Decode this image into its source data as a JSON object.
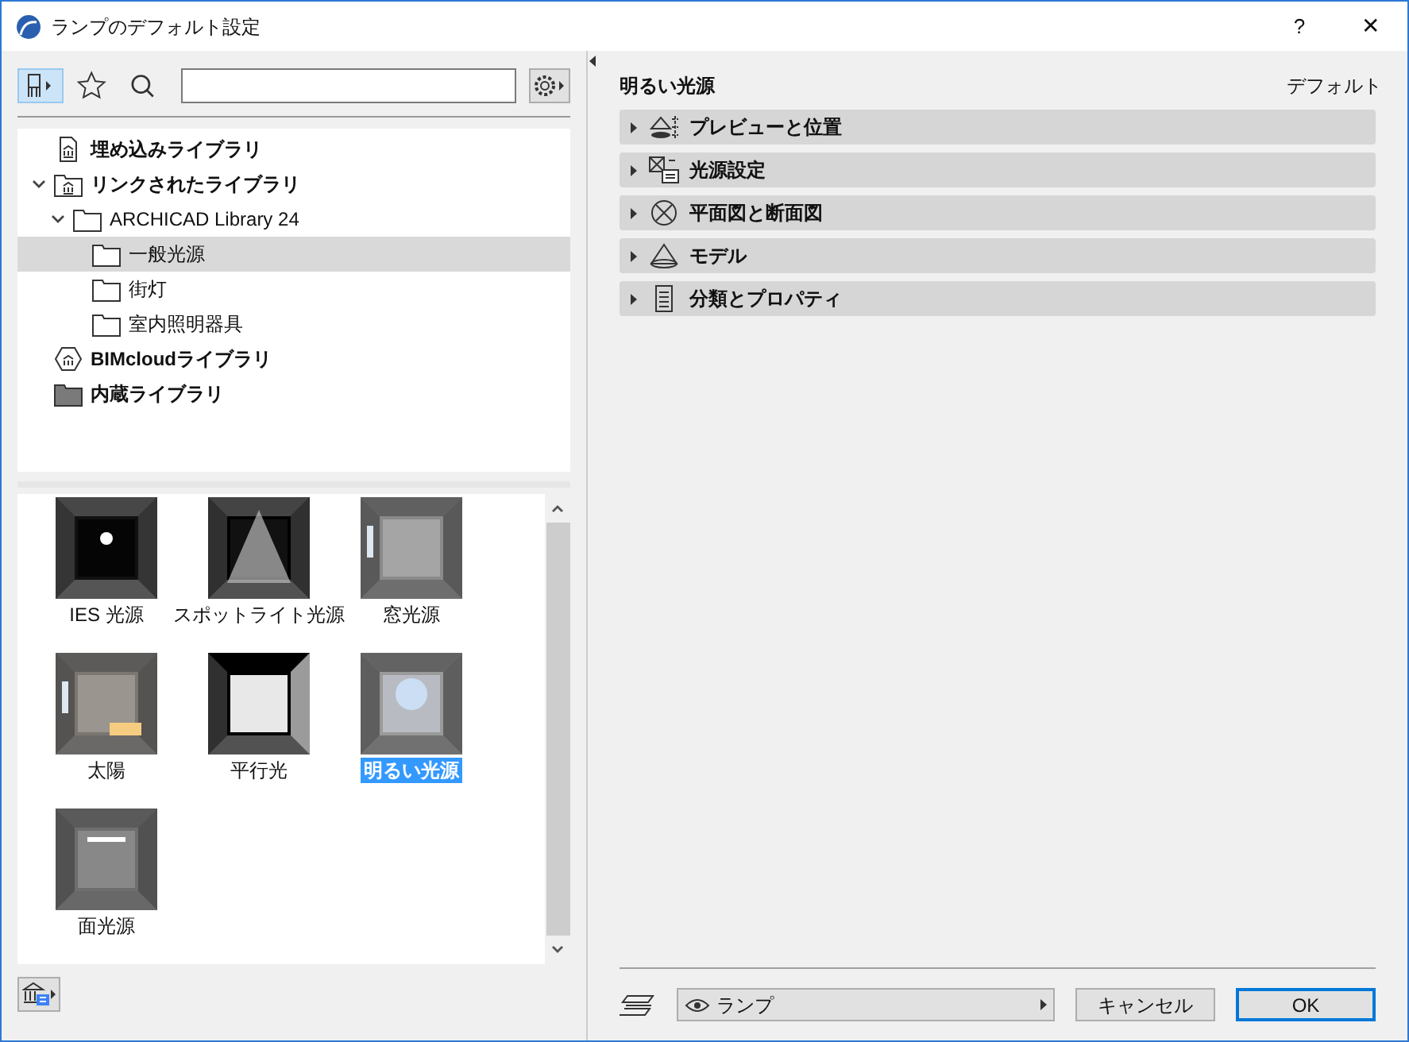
{
  "window": {
    "title": "ランプのデフォルト設定",
    "help": "?",
    "close": "✕"
  },
  "tree": [
    {
      "kind": "embedded",
      "label": "埋め込みライブラリ",
      "bold": true,
      "selected": false
    },
    {
      "kind": "linked",
      "label": "リンクされたライブラリ",
      "bold": true,
      "selected": false,
      "expanded": true,
      "children": [
        {
          "kind": "folder",
          "label": "ARCHICAD Library 24",
          "bold": false,
          "selected": false,
          "expanded": true,
          "children": [
            {
              "kind": "folder",
              "label": "一般光源",
              "bold": false,
              "selected": true
            },
            {
              "kind": "folder",
              "label": "街灯",
              "bold": false,
              "selected": false
            },
            {
              "kind": "folder",
              "label": "室内照明器具",
              "bold": false,
              "selected": false
            }
          ]
        }
      ]
    },
    {
      "kind": "bimcloud",
      "label": "BIMcloudライブラリ",
      "bold": true,
      "selected": false
    },
    {
      "kind": "builtin",
      "label": "内蔵ライブラリ",
      "bold": true,
      "selected": false
    }
  ],
  "gallery": [
    {
      "label": "IES 光源",
      "selected": false
    },
    {
      "label": "スポットライト光源",
      "selected": false
    },
    {
      "label": "窓光源",
      "selected": false
    },
    {
      "label": "太陽",
      "selected": false
    },
    {
      "label": "平行光",
      "selected": false
    },
    {
      "label": "明るい光源",
      "selected": true
    },
    {
      "label": "面光源",
      "selected": false
    }
  ],
  "settings": {
    "title": "明るい光源",
    "default_label": "デフォルト",
    "sections": [
      {
        "kind": "preview",
        "label": "プレビューと位置",
        "expanded": false
      },
      {
        "kind": "params",
        "label": "光源設定",
        "expanded": false
      },
      {
        "kind": "plan",
        "label": "平面図と断面図",
        "expanded": false
      },
      {
        "kind": "model",
        "label": "モデル",
        "expanded": false
      },
      {
        "kind": "classification",
        "label": "分類とプロパティ",
        "expanded": false
      }
    ]
  },
  "footer": {
    "layer": "ランプ",
    "cancel": "キャンセル",
    "ok": "OK"
  }
}
